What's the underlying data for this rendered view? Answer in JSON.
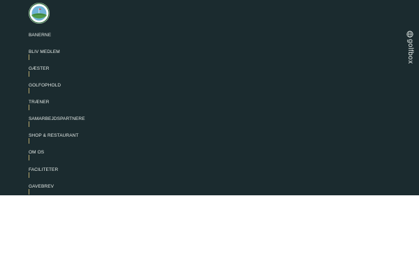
{
  "logo": {
    "alt": "club logo"
  },
  "menu": {
    "items": [
      {
        "label": "BANERNE"
      },
      {
        "label": "BLIV MEDLEM"
      },
      {
        "label": "GÆSTER"
      },
      {
        "label": "GOLFOPHOLD"
      },
      {
        "label": "TRÆNER"
      },
      {
        "label": "SAMARBEJDSPARTNERE"
      },
      {
        "label": "SHOP & RESTAURANT"
      },
      {
        "label": "OM OS"
      },
      {
        "label": "FACILITETER"
      },
      {
        "label": "GAVEBREV"
      }
    ]
  },
  "side_link": {
    "label": "golfbox",
    "icon": "globe-icon"
  },
  "colors": {
    "panel": "#1b2b2f",
    "text": "#e6ece9",
    "accent_tick": "#b8a86d"
  }
}
